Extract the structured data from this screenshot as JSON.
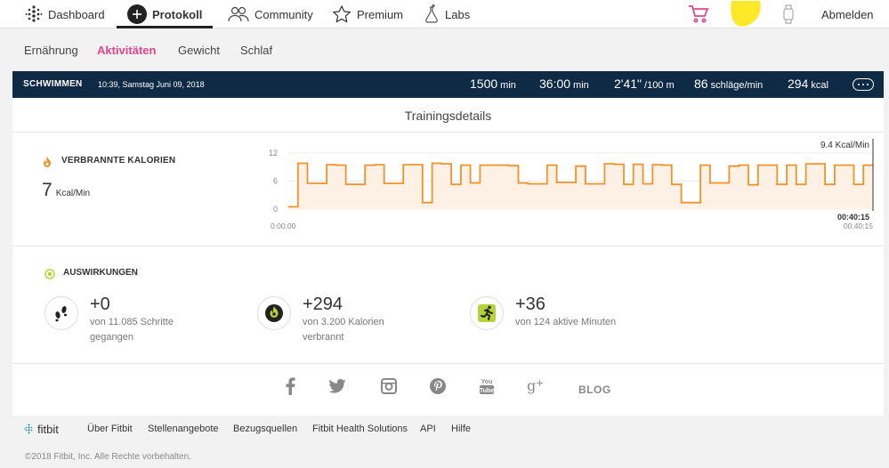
{
  "nav": {
    "dashboard": "Dashboard",
    "protokoll": "Protokoll",
    "community": "Community",
    "premium": "Premium",
    "labs": "Labs",
    "logout": "Abmelden"
  },
  "subnav": [
    "Ernährung",
    "Aktivitäten",
    "Gewicht",
    "Schlaf"
  ],
  "activity": {
    "title": "SCHWIMMEN",
    "datetime": "10:39, Samstag Juni 09, 2018",
    "stats": [
      {
        "value": "1500",
        "unit": "min"
      },
      {
        "value": "36:00",
        "unit": "min"
      },
      {
        "value": "2'41\"",
        "unit": "/100 m"
      },
      {
        "value": "86",
        "unit": "schläge/min"
      },
      {
        "value": "294",
        "unit": "kcal"
      }
    ]
  },
  "details_title": "Trainingsdetails",
  "calories": {
    "label": "VERBRANNTE KALORIEN",
    "value": "7",
    "unit": "Kcal/Min"
  },
  "chart_data": {
    "type": "area",
    "y_ticks": [
      "12",
      "6",
      "0"
    ],
    "ylim": [
      0,
      12
    ],
    "x_start_label": "0:00:00",
    "x_end_label": "00:40:15",
    "cursor_time_label": "00:40:15",
    "cursor_value_label": "9.4 Kcal/Min",
    "values": [
      0.5,
      9.8,
      5.5,
      5.5,
      9.5,
      9.4,
      5.3,
      5.3,
      9.4,
      9.5,
      5.5,
      5.5,
      9.5,
      9.5,
      1.4,
      9.8,
      9.7,
      5.3,
      9.4,
      5.6,
      9.4,
      9.4,
      9.4,
      9.3,
      5.6,
      5.4,
      5.4,
      9.4,
      5.7,
      5.7,
      9.2,
      5.4,
      5.4,
      9.7,
      9.6,
      5.3,
      9.6,
      5.4,
      9.5,
      9.4,
      5.3,
      1.4,
      1.4,
      9.4,
      5.6,
      5.6,
      9.2,
      9.4,
      5.2,
      9.4,
      9.4,
      5.3,
      9.4,
      5.3,
      9.7,
      9.7,
      5.3,
      9.4,
      9.4,
      5.3,
      9.4
    ],
    "color": "#f0932b",
    "grid": true
  },
  "impacts": {
    "label": "AUSWIRKUNGEN",
    "items": [
      {
        "value": "+0",
        "line1": "von 11.085 Schritte",
        "line2": "gegangen",
        "icon": "footsteps-icon"
      },
      {
        "value": "+294",
        "line1": "von 3.200 Kalorien",
        "line2": "verbrannt",
        "icon": "flame-icon"
      },
      {
        "value": "+36",
        "line1": "von 124 aktive Minuten",
        "line2": "",
        "icon": "runner-icon"
      }
    ]
  },
  "social_blog": "BLOG",
  "footer": {
    "logo": "fitbit",
    "links": [
      "Über Fitbit",
      "Stellenangebote",
      "Bezugsquellen",
      "Fitbit Health Solutions",
      "API",
      "Hilfe"
    ],
    "copyright": "©2018 Fitbit, Inc. Alle Rechte vorbehalten."
  },
  "colors": {
    "accent": "#e0468c",
    "header": "#0e2a44",
    "chart": "#f0932b",
    "impact_green": "#b6d23a"
  }
}
